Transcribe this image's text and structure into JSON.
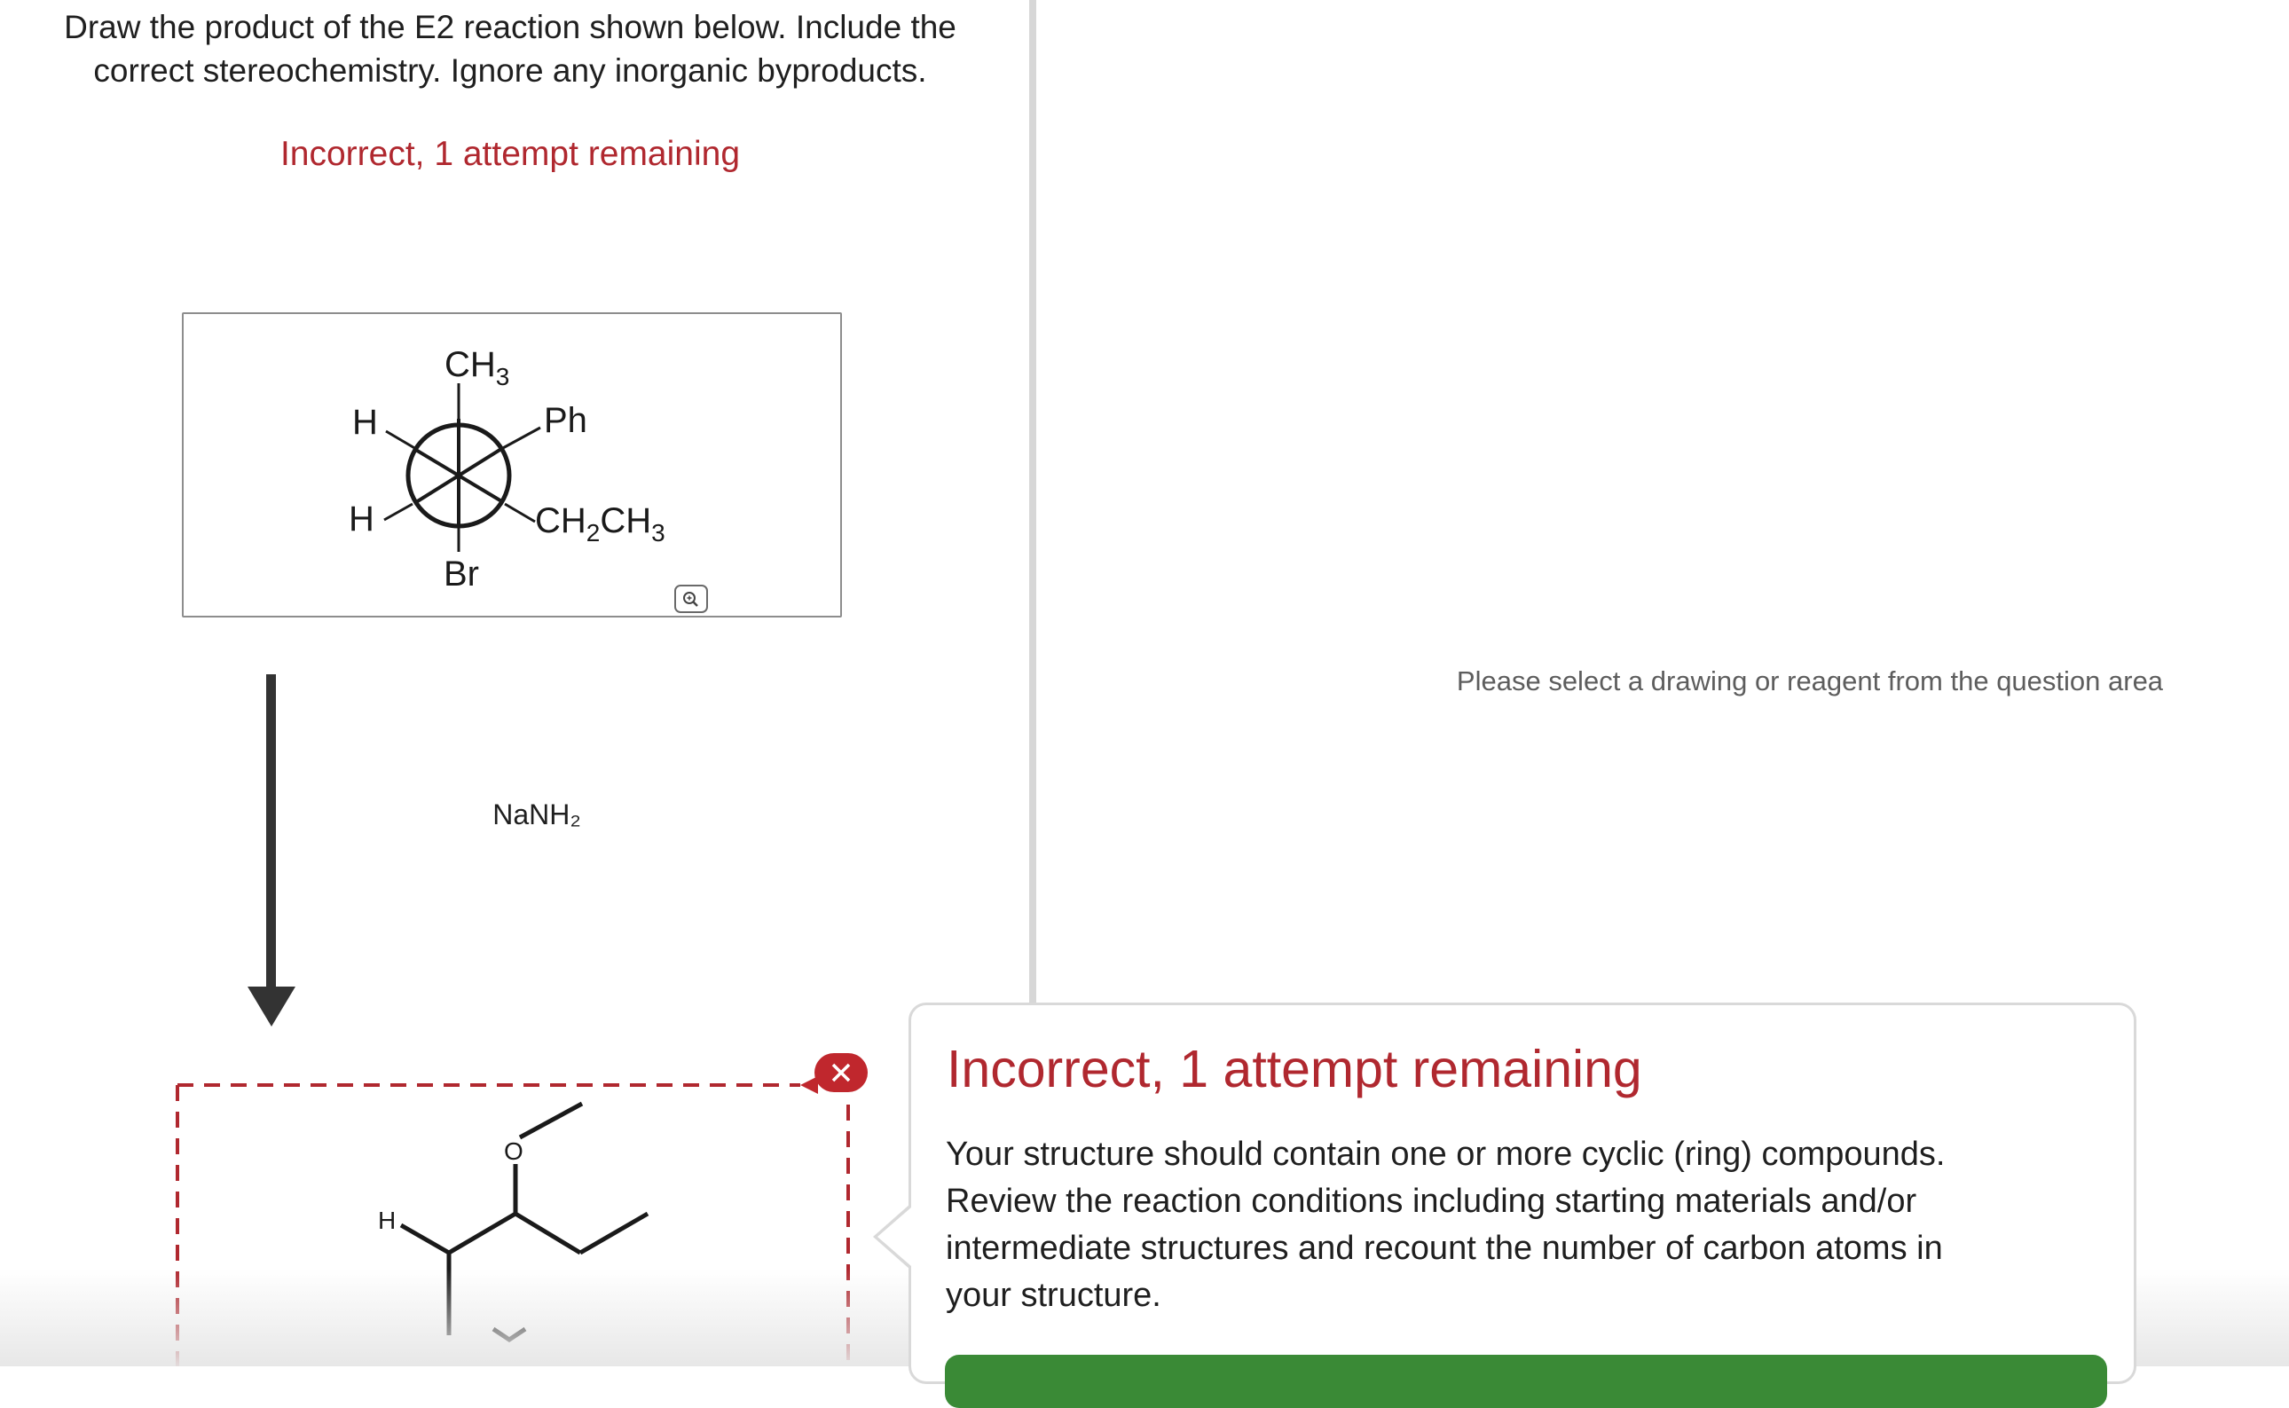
{
  "question": {
    "line1": "Draw the product of the E2 reaction shown below. Include the",
    "line2": "correct stereochemistry. Ignore any inorganic byproducts."
  },
  "status": {
    "text": "Incorrect, 1 attempt remaining",
    "color": "#b0282f"
  },
  "starting_material": {
    "front_top": "CH",
    "front_top_sub": "3",
    "front_left_upper": "H",
    "front_right_upper": "Ph",
    "back_left": "H",
    "back_right_main": "CH",
    "back_right_sub1": "2",
    "back_right_mid": "CH",
    "back_right_sub2": "3",
    "back_bottom": "Br",
    "zoom_icon": "magnifier-icon"
  },
  "reagent": {
    "label": "NaNH₂"
  },
  "answer": {
    "atom_o": "O",
    "atom_h": "H",
    "remove_icon": "close-icon",
    "expand_icon": "chevron-down-icon"
  },
  "side_panel": {
    "hint": "Please select a drawing or reagent from the question area"
  },
  "feedback": {
    "title": "Incorrect, 1 attempt remaining",
    "line1": "Your structure should contain one or more cyclic (ring) compounds.",
    "line2": "Review the reaction conditions including starting materials and/or",
    "line3": "intermediate structures and recount the number of carbon atoms in",
    "line4": "your structure.",
    "button_color": "#3a8a36"
  }
}
